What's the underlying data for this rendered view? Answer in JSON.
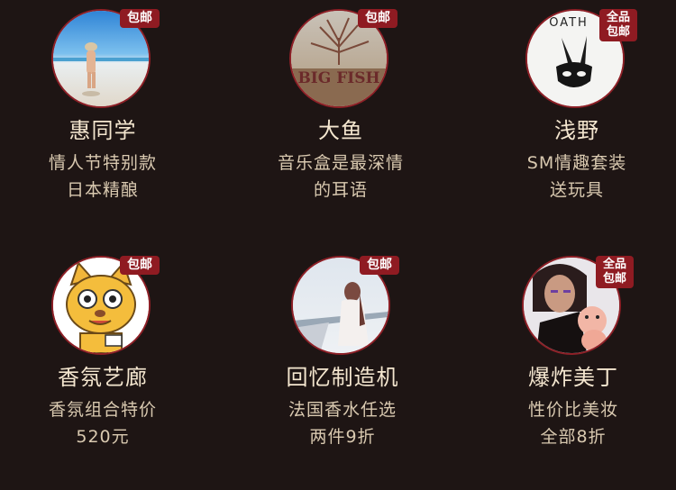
{
  "shops": [
    {
      "name": "惠同学",
      "promo_line1": "情人节特别款",
      "promo_line2": "日本精酿",
      "badge_line1": "包邮",
      "badge_line2": ""
    },
    {
      "name": "大鱼",
      "promo_line1": "音乐盒是最深情",
      "promo_line2": "的耳语",
      "badge_line1": "包邮",
      "badge_line2": "",
      "avatar_text": "BIG FISH"
    },
    {
      "name": "浅野",
      "promo_line1": "SM情趣套装",
      "promo_line2": "送玩具",
      "badge_line1": "全品",
      "badge_line2": "包邮",
      "avatar_text": "OATH"
    },
    {
      "name": "香氛艺廊",
      "promo_line1": "香氛组合特价",
      "promo_line2": "520元",
      "badge_line1": "包邮",
      "badge_line2": ""
    },
    {
      "name": "回忆制造机",
      "promo_line1": "法国香水任选",
      "promo_line2": "两件9折",
      "badge_line1": "包邮",
      "badge_line2": ""
    },
    {
      "name": "爆炸美丁",
      "promo_line1": "性价比美妆",
      "promo_line2": "全部8折",
      "badge_line1": "全品",
      "badge_line2": "包邮"
    }
  ],
  "colors": {
    "background": "#1e1514",
    "badge": "#8f1b22",
    "ring": "#8e2027",
    "title": "#f4e6cf",
    "subtitle": "#d9c9b0"
  }
}
